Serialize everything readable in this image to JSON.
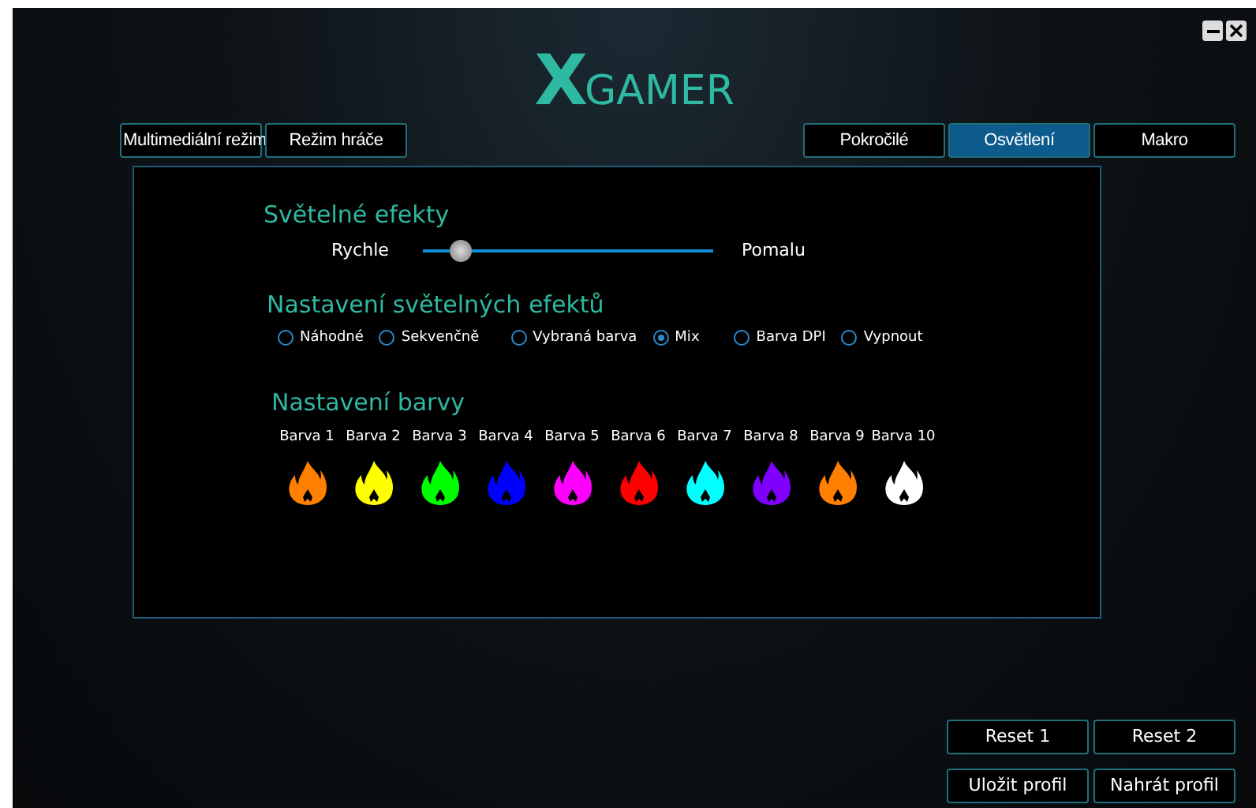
{
  "logo": {
    "mark": "X",
    "text": "GAMER"
  },
  "window_controls": [
    {
      "kind": "minimize"
    },
    {
      "kind": "close"
    }
  ],
  "mode_tabs": [
    {
      "label": "Multimediální režim",
      "selected": false
    },
    {
      "label": "Režim hráče",
      "selected": false
    }
  ],
  "tabs": [
    {
      "label": "Pokročilé",
      "selected": false
    },
    {
      "label": "Osvětlení",
      "selected": true
    },
    {
      "label": "Makro",
      "selected": false
    }
  ],
  "light_effects": {
    "title": "Světelné efekty",
    "left_label": "Rychle",
    "right_label": "Pomalu",
    "level": 0.13
  },
  "effect_settings": {
    "title": "Nastavení světelných efektů",
    "options": [
      {
        "label": "Náhodné",
        "selected": false
      },
      {
        "label": "Sekvenčně",
        "selected": false
      },
      {
        "label": "Vybraná barva",
        "selected": false
      },
      {
        "label": "Mix",
        "selected": true
      },
      {
        "label": "Barva DPI",
        "selected": false
      },
      {
        "label": "Vypnout",
        "selected": false
      }
    ]
  },
  "color_settings": {
    "title": "Nastavení barvy",
    "colors": [
      {
        "label": "Barva 1",
        "color": "#ff8000"
      },
      {
        "label": "Barva 2",
        "color": "#ffff00"
      },
      {
        "label": "Barva 3",
        "color": "#00ff00"
      },
      {
        "label": "Barva 4",
        "color": "#0000ff"
      },
      {
        "label": "Barva 5",
        "color": "#ff00ff"
      },
      {
        "label": "Barva 6",
        "color": "#ff0000"
      },
      {
        "label": "Barva 7",
        "color": "#00ffff"
      },
      {
        "label": "Barva 8",
        "color": "#8000ff"
      },
      {
        "label": "Barva 9",
        "color": "#ff8000"
      },
      {
        "label": "Barva 10",
        "color": "#ffffff"
      }
    ]
  },
  "buttons": [
    {
      "label": "Reset 1"
    },
    {
      "label": "Reset 2"
    },
    {
      "label": "Uložit profil"
    },
    {
      "label": "Nahrát profil"
    }
  ]
}
